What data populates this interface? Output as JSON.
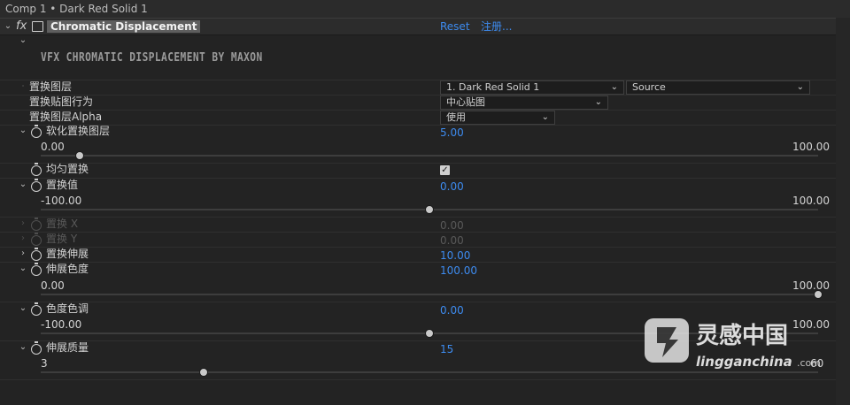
{
  "window": {
    "title": "Comp 1 • Dark Red Solid 1"
  },
  "effect": {
    "fx_icon": "fx",
    "name": "Chromatic Displacement",
    "reset_label": "Reset",
    "register_label": "注册...",
    "banner": "VFX CHROMATIC DISPLACEMENT BY MAXON"
  },
  "params": {
    "displace_layer": {
      "label": "置换图层",
      "value": "1. Dark Red Solid 1",
      "source_value": "Source"
    },
    "map_behavior": {
      "label": "置换贴图行为",
      "value": "中心贴图"
    },
    "layer_alpha": {
      "label": "置换图层Alpha",
      "value": "使用"
    },
    "soften": {
      "label": "软化置换图层",
      "value": "5.00",
      "min": "0.00",
      "max": "100.00",
      "fraction": 0.05
    },
    "uniform": {
      "label": "均匀置换",
      "checked": true,
      "check_glyph": "✓"
    },
    "amount": {
      "label": "置换值",
      "value": "0.00",
      "min": "-100.00",
      "max": "100.00",
      "fraction": 0.5
    },
    "displace_x": {
      "label": "置换 X",
      "value": "0.00"
    },
    "displace_y": {
      "label": "置换 Y",
      "value": "0.00"
    },
    "spread": {
      "label": "置换伸展",
      "value": "10.00"
    },
    "spread_chroma": {
      "label": "伸展色度",
      "value": "100.00",
      "min": "0.00",
      "max": "100.00",
      "fraction": 1.0
    },
    "chroma_hue": {
      "label": "色度色调",
      "value": "0.00",
      "min": "-100.00",
      "max": "100.00",
      "fraction": 0.5
    },
    "spread_quality": {
      "label": "伸展质量",
      "value": "15",
      "min": "3",
      "max": "60",
      "fraction": 0.21
    }
  },
  "watermark": {
    "brand": "灵感中国",
    "url": "lingganchina",
    "suffix": ".com"
  }
}
